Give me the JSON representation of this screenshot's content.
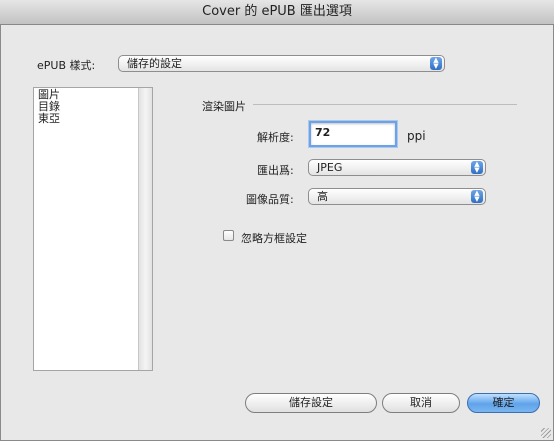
{
  "window": {
    "title": "Cover 的 ePUB 匯出選項"
  },
  "style_row": {
    "label": "ePUB 樣式:",
    "selected": "儲存的設定"
  },
  "sidebar": {
    "items": [
      {
        "label": "圖片"
      },
      {
        "label": "目錄"
      },
      {
        "label": "東亞"
      }
    ]
  },
  "panel": {
    "section_title": "渲染圖片",
    "resolution": {
      "label": "解析度:",
      "value": "72",
      "unit": "ppi"
    },
    "format": {
      "label": "匯出爲:",
      "selected": "JPEG"
    },
    "quality": {
      "label": "圖像品質:",
      "selected": "高"
    },
    "ignore_frame": {
      "label": "忽略方框設定",
      "checked": false
    }
  },
  "buttons": {
    "save_settings": "儲存設定",
    "cancel": "取消",
    "ok": "確定"
  },
  "colors": {
    "accent": "#5fa3ea",
    "focus_ring": "#6ea2e6"
  }
}
